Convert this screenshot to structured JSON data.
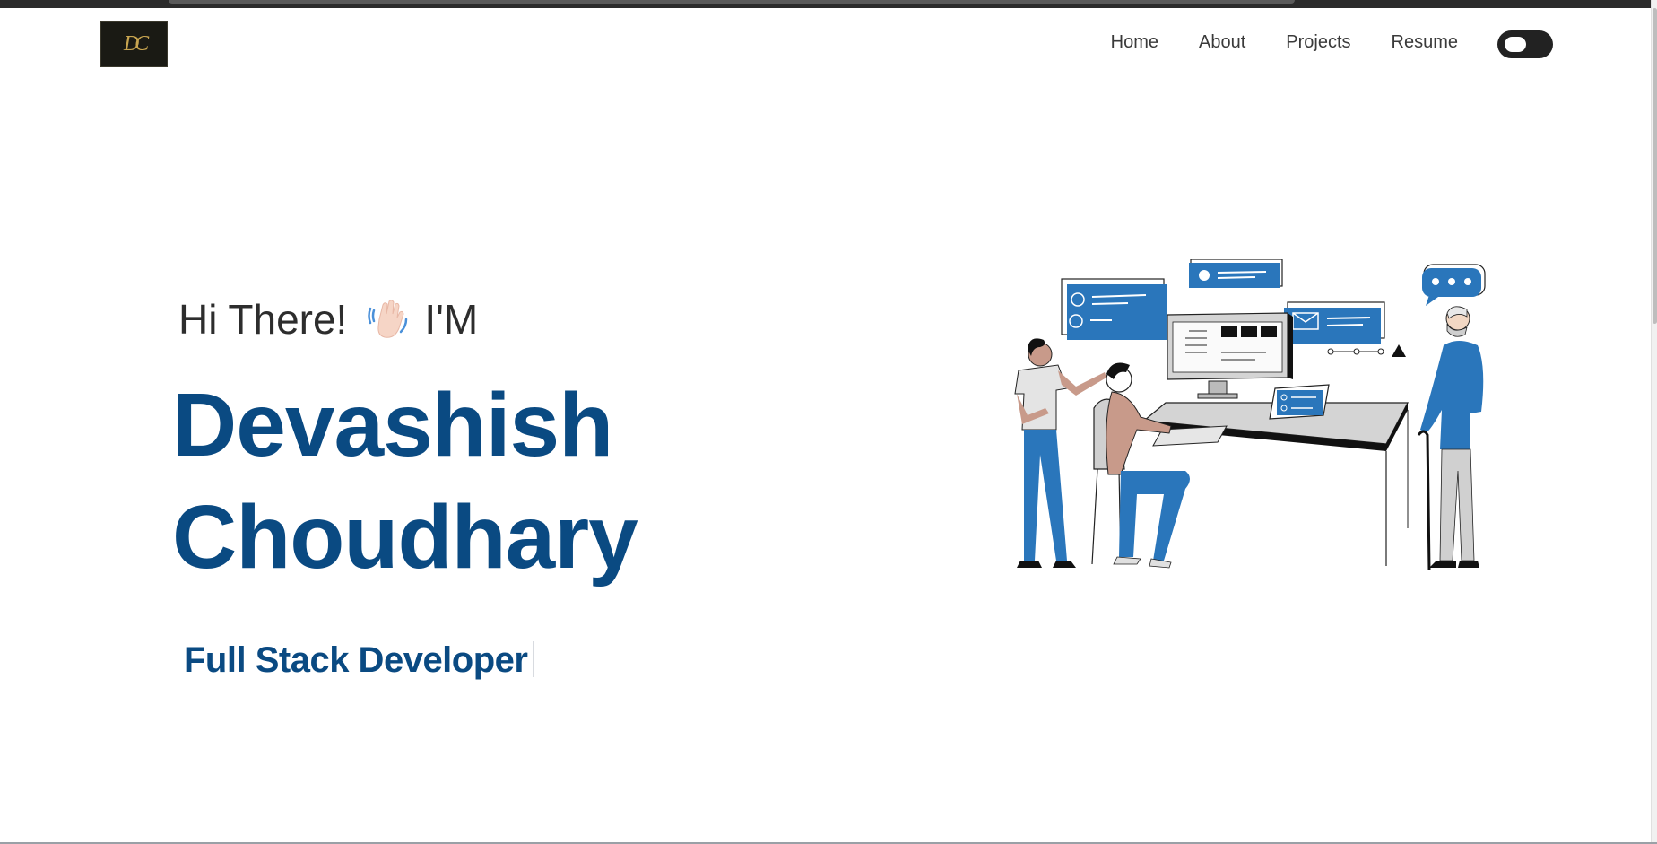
{
  "logo": {
    "text": "DC"
  },
  "nav": {
    "items": [
      {
        "label": "Home"
      },
      {
        "label": "About"
      },
      {
        "label": "Projects"
      },
      {
        "label": "Resume"
      }
    ],
    "theme_toggle": {
      "state": "off"
    }
  },
  "hero": {
    "greeting_start": "Hi There!",
    "greeting_end": "I'M",
    "first_name": "Devashish",
    "last_name": "Choudhary",
    "role": "Full Stack Developer"
  },
  "colors": {
    "accent": "#0a4a82",
    "illustration_blue": "#2a76bb",
    "text": "#2d2d2d"
  }
}
